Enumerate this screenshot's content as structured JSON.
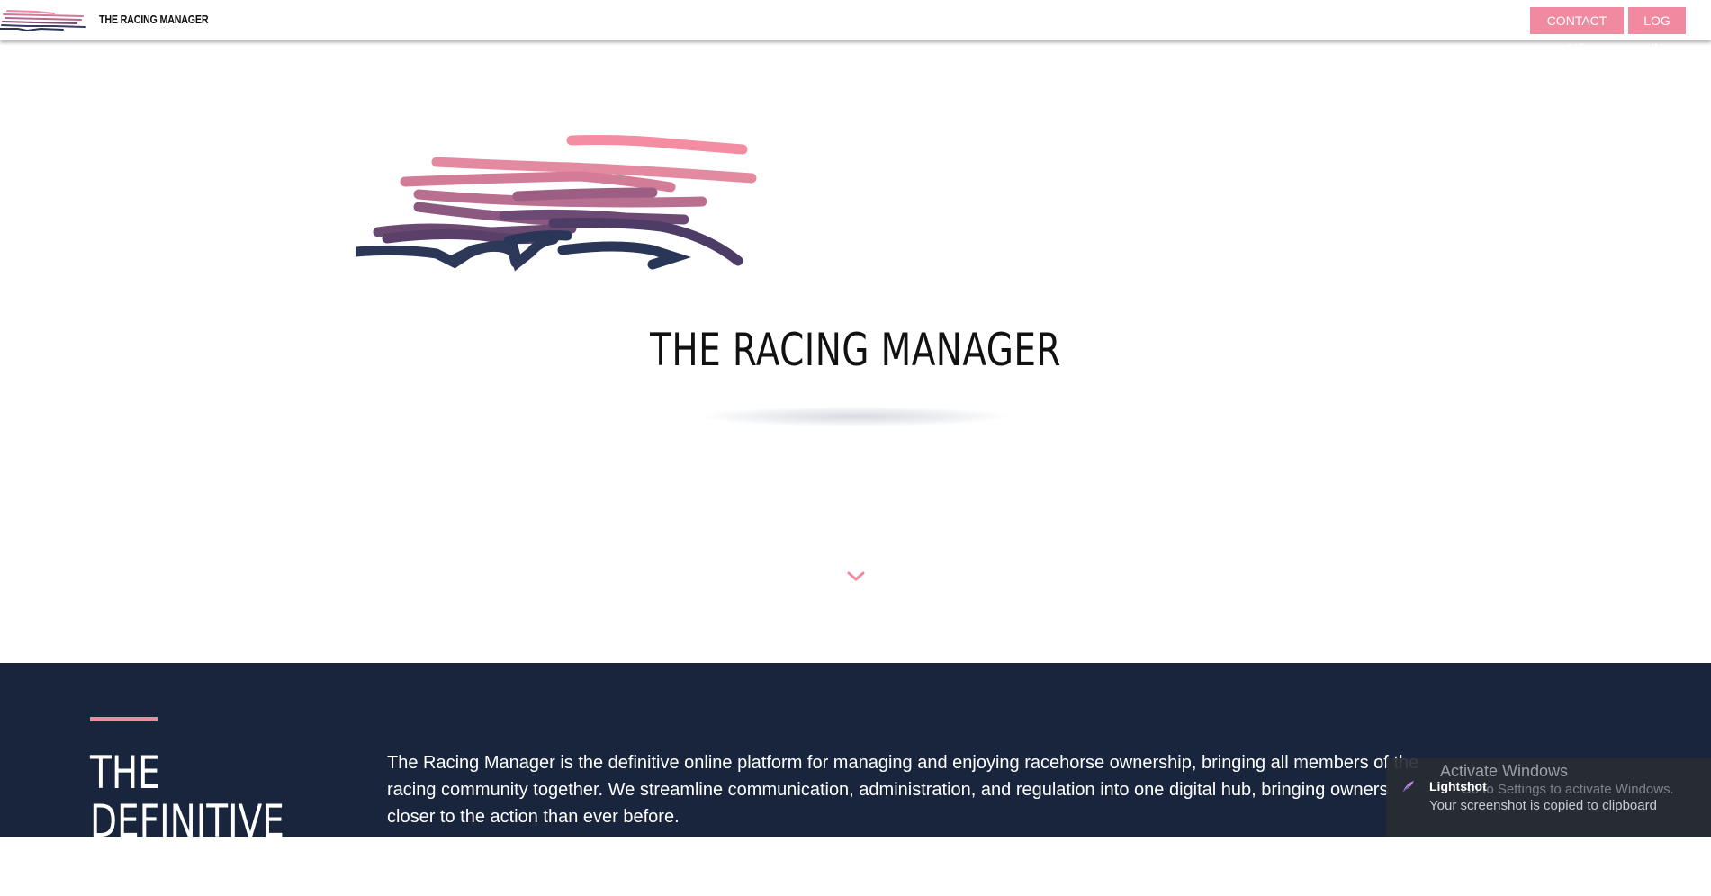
{
  "header": {
    "brand": "THE RACING MANAGER",
    "contact_label": "CONTACT US",
    "login_label": "LOG IN"
  },
  "hero": {
    "title": "THE RACING MANAGER",
    "scroll_icon": "chevron-down-icon"
  },
  "about": {
    "heading": "THE DEFINITIVE\nPLATFORM",
    "body": "The Racing Manager is the definitive online platform for managing and enjoying racehorse ownership, bringing all members of the racing community together. We streamline communication, administration, and regulation into one digital hub, bringing owners closer to the action than ever before."
  },
  "overlay": {
    "activate_title": "Activate Windows",
    "activate_sub": "Go to Settings to activate Windows.",
    "app_name": "Lightshot",
    "message": "Your screenshot is copied to clipboard"
  },
  "colors": {
    "accent": "#f08aa0",
    "navy": "#19253c",
    "logo_navy": "#2a3657"
  }
}
